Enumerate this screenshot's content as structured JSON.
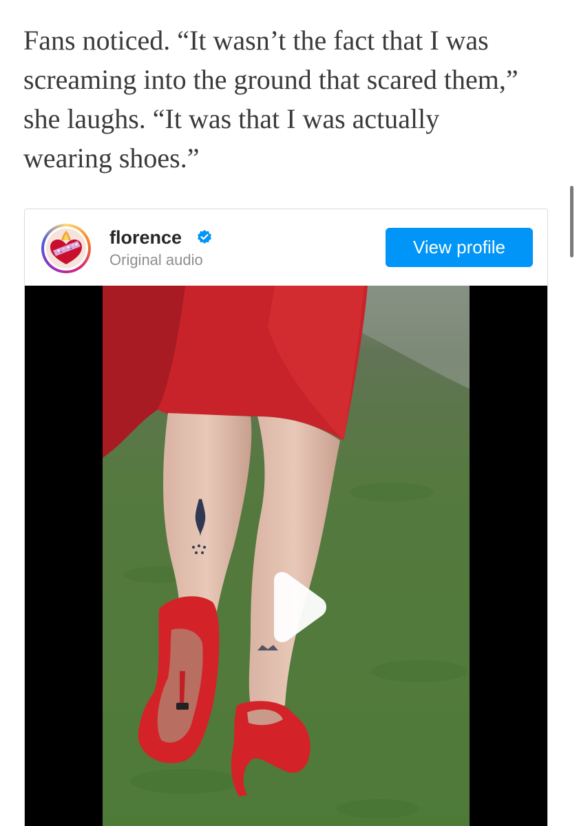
{
  "article": {
    "lines": [
      "Fans noticed. “It wasn’t the fact that I was",
      "screaming into the ground that scared them,”",
      "she laughs. “It was that I was actually",
      "wearing shoes.”"
    ]
  },
  "embed": {
    "username": "florence",
    "verified_icon": "verified-badge-icon",
    "subtitle": "Original audio",
    "view_profile_label": "View profile",
    "accent_color": "#0095f6",
    "video": {
      "play_icon": "play-icon"
    }
  }
}
